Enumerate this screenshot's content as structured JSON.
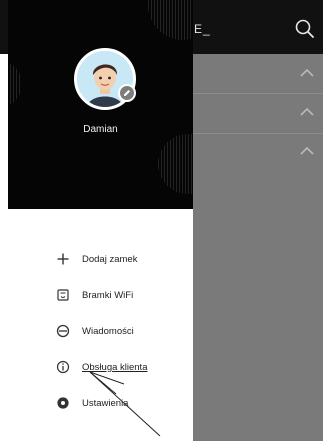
{
  "app": {
    "title_fragment": "E_",
    "icons": {
      "search": "search-icon",
      "chevron": "chevron-up-icon"
    }
  },
  "drawer": {
    "user": {
      "name": "Damian"
    },
    "items": [
      {
        "label": "Dodaj zamek",
        "icon": "plus-icon"
      },
      {
        "label": "Bramki WiFi",
        "icon": "wifi-gateway-icon"
      },
      {
        "label": "Wiadomości",
        "icon": "message-icon"
      },
      {
        "label": "Obsługa klienta",
        "icon": "info-icon"
      },
      {
        "label": "Ustawienia",
        "icon": "settings-icon"
      }
    ]
  },
  "colors": {
    "header_bg": "#050505",
    "overlay_bg": "#7a7a7a",
    "text": "#222222"
  }
}
